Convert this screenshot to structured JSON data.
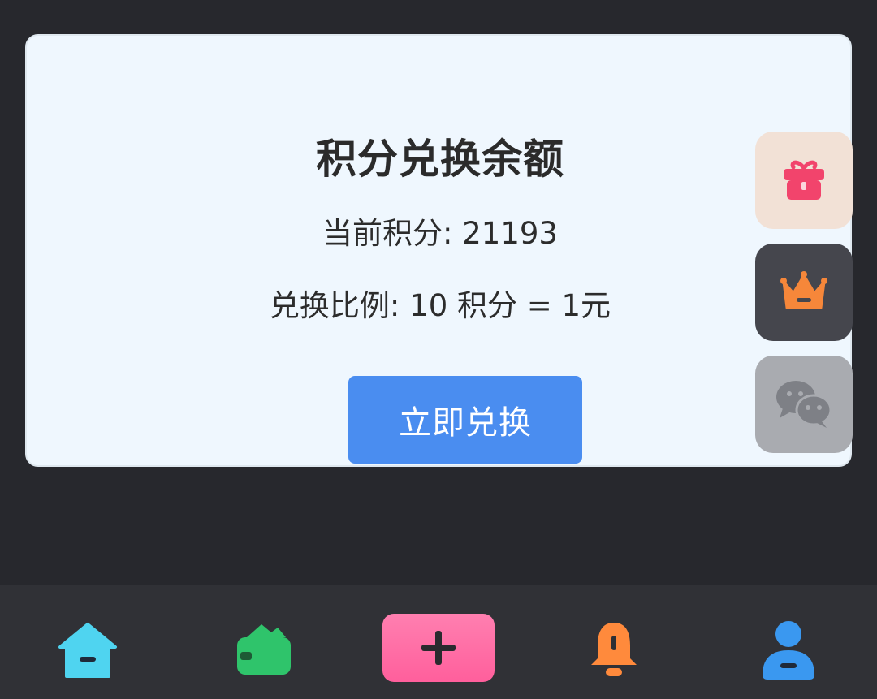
{
  "card": {
    "title": "积分兑换余额",
    "points_line": "当前积分: 21193",
    "ratio_line": "兑换比例: 10 积分 = 1元",
    "redeem_button": "立即兑换"
  },
  "floating_buttons": [
    {
      "icon": "gift-icon",
      "color": "#f2446c",
      "bg": "#f2e1d6"
    },
    {
      "icon": "crown-icon",
      "color": "#f6873a",
      "bg": "#45464d"
    },
    {
      "icon": "wechat-icon",
      "color": "#7e8086",
      "bg": "#a9abb0"
    }
  ],
  "bottom_nav": [
    {
      "icon": "home-icon",
      "color": "#4fd4f0"
    },
    {
      "icon": "wallet-icon",
      "color": "#2fc46b"
    },
    {
      "icon": "plus-icon",
      "color": "#ff62a0"
    },
    {
      "icon": "bell-icon",
      "color": "#ff8a3c"
    },
    {
      "icon": "user-icon",
      "color": "#3a98f0"
    }
  ]
}
